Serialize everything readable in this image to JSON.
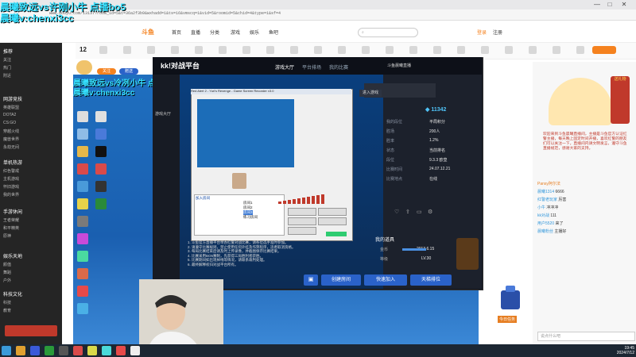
{
  "browser": {
    "url": "www.douyu.com/13137?room_id=5&t=36a2f3b9&wxhadd=1&ts=16&vmscq=1&vid=5&roomid=5&chid=4&type=1&sf=4",
    "controls": [
      "—",
      "□",
      "✕"
    ]
  },
  "site": {
    "logo": "斗鱼",
    "nav": [
      "首页",
      "直播",
      "分类",
      "游戏",
      "娱乐",
      "鱼吧"
    ],
    "login": "登录",
    "register": "注册"
  },
  "streamer": {
    "number": "12",
    "badges": [
      "关注",
      "赠送"
    ]
  },
  "watermark": {
    "line1": "晨曦致远vs许刚小牛 点播bo5",
    "line2": "晨曦v:chenxi3cc",
    "line3": "晨曦致远vs冷冽小牛 点",
    "line4": "晨曦v:chenxi3cc"
  },
  "dialog": {
    "logo": "kk!对战平台",
    "tabs": [
      "游戏大厅",
      "平台排场",
      "我的比赛"
    ],
    "user_label": "斗鱼晨曦直播",
    "side_label": "游戏大厅",
    "game_button": "进入游戏",
    "score": "11342",
    "kv": [
      {
        "label": "我的段位",
        "value": "平局积分"
      },
      {
        "label": "胜场",
        "value": "200人"
      },
      {
        "label": "胜率",
        "value": "1.2%"
      },
      {
        "label": "状态",
        "value": "当前排名"
      },
      {
        "label": "段位",
        "value": "9.3.3 欧皇"
      },
      {
        "label": "比赛时间",
        "value": "24.07.12.21"
      },
      {
        "label": "比赛地点",
        "value": "在线"
      }
    ],
    "inner_title": "Red Alert 2 - Yuri's Revenge - Game Screen Recorder v3.0",
    "inner_list": [
      "加入房间",
      "房间1",
      "房间2",
      "房间3",
      "练习房间"
    ],
    "rules": [
      "1. 斗鱼官方直播平台举办红警对战比赛，请各位选手准时参加。",
      "2. 请遵守比赛规则，禁止使用任何外挂及作弊程序，违者取消资格。",
      "3. 每局比赛结束后请及时上传录像，并截图保存比赛结果。",
      "4. 比赛采用BO5赛制，先获得三局胜利者获胜。",
      "5. 比赛期间如出现掉线等情况，请联系裁判处理。",
      "6. 最终解释权归对战平台所有。"
    ],
    "buttons": [
      "创建房间",
      "快速加入",
      "天梯排位"
    ],
    "match_section": "我的道具",
    "match_rows": [
      {
        "label": "金币",
        "value": "2013.6.15"
      },
      {
        "label": "等级",
        "value": "LV.30"
      }
    ]
  },
  "right": {
    "announce": "欢迎来到斗鱼晨曦直播间，主播是斗鱼官方认证红警主播，每天晚上固定时间开播，喜欢红警的朋友们可以关注一下，直播间内请文明发言，遵守斗鱼直播规范，感谢大家的支持。",
    "chat": [
      {
        "user": "Pansy阿尔法",
        "text": ""
      },
      {
        "user": "晨曦1314",
        "text": "6666"
      },
      {
        "user": "红警老玩家",
        "text": "厉害"
      },
      {
        "user": "小牛",
        "text": "冲冲冲"
      },
      {
        "user": "kk对战",
        "text": "111"
      },
      {
        "user": "用户5520",
        "text": "来了"
      },
      {
        "user": "晨曦粉丝",
        "text": "主播好"
      }
    ],
    "vip_label": "送礼物",
    "gift_label": "今日任务",
    "input_hint": "说点什么吧"
  },
  "taskbar": {
    "time": "19:45",
    "date": "2024/7/12"
  },
  "sidebar": {
    "sections": [
      {
        "title": "推荐",
        "items": [
          "关注",
          "热门",
          "附近"
        ]
      },
      {
        "title": "网游竞技",
        "items": [
          "英雄联盟",
          "DOTA2",
          "CS:GO",
          "穿越火线",
          "魔兽世界",
          "永劫无间"
        ]
      },
      {
        "title": "单机热游",
        "items": [
          "红色警戒",
          "主机游戏",
          "怀旧游戏",
          "我的世界"
        ]
      },
      {
        "title": "手游休闲",
        "items": [
          "王者荣耀",
          "和平精英",
          "原神"
        ]
      },
      {
        "title": "娱乐天地",
        "items": [
          "颜值",
          "舞蹈",
          "户外"
        ]
      },
      {
        "title": "科技文化",
        "items": [
          "科技",
          "教育"
        ]
      }
    ]
  }
}
